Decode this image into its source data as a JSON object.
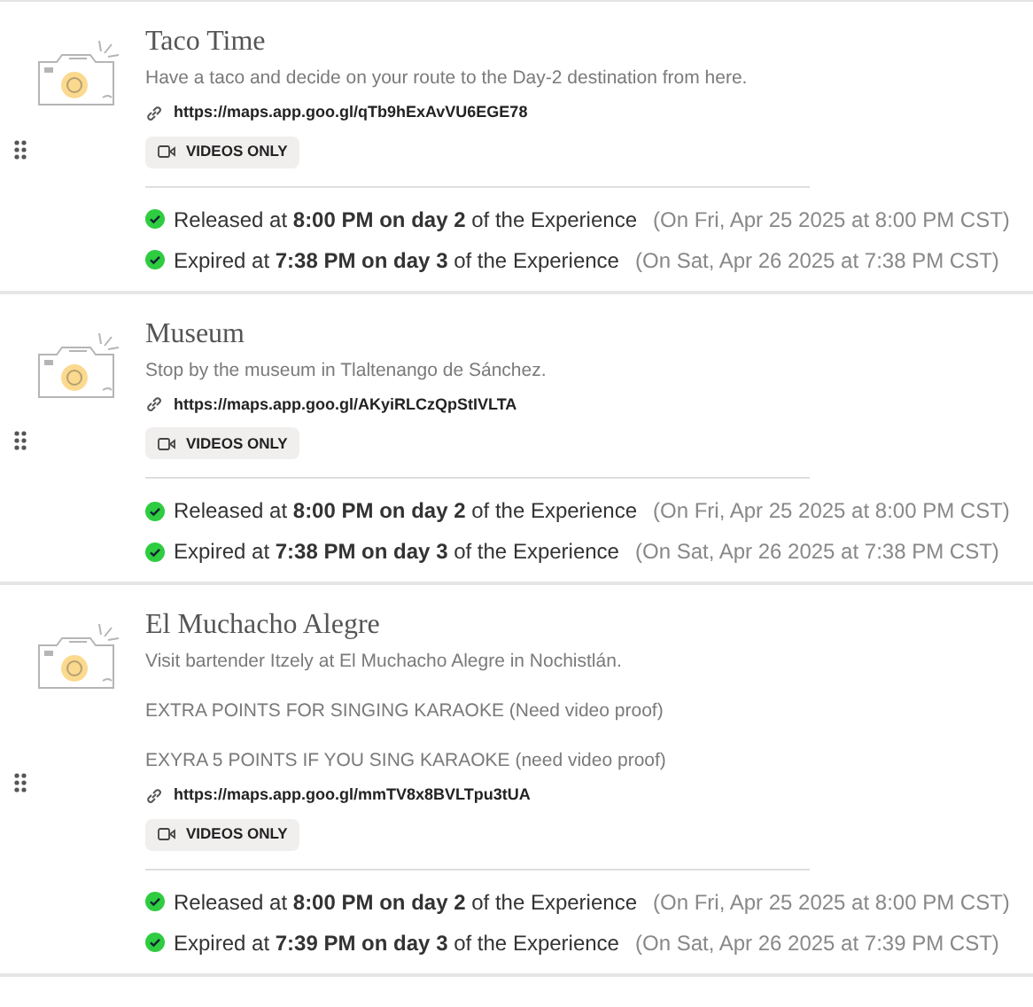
{
  "items": [
    {
      "title": "Taco Time",
      "description": [
        "Have a taco and decide on your route to the Day-2 destination from here."
      ],
      "link": "https://maps.app.goo.gl/qTb9hExAvVU6EGE78",
      "badge": "VIDEOS ONLY",
      "schedule": [
        {
          "text": "Released at **8:00 PM on day 2** of the Experience",
          "date": "(On Fri, Apr 25 2025 at 8:00 PM CST)",
          "done": true
        },
        {
          "text": "Expired at **7:38 PM on day 3** of the Experience",
          "date": "(On Sat, Apr 26 2025 at 7:38 PM CST)",
          "done": true
        }
      ]
    },
    {
      "title": "Museum",
      "description": [
        "Stop by the museum in Tlaltenango de Sánchez."
      ],
      "link": "https://maps.app.goo.gl/AKyiRLCzQpStIVLTA",
      "badge": "VIDEOS ONLY",
      "schedule": [
        {
          "text": "Released at **8:00 PM on day 2** of the Experience",
          "date": "(On Fri, Apr 25 2025 at 8:00 PM CST)",
          "done": true
        },
        {
          "text": "Expired at **7:38 PM on day 3** of the Experience",
          "date": "(On Sat, Apr 26 2025 at 7:38 PM CST)",
          "done": true
        }
      ]
    },
    {
      "title": "El Muchacho Alegre",
      "description": [
        "Visit bartender Itzely at El Muchacho Alegre in Nochistlán.",
        "EXTRA POINTS FOR SINGING KARAOKE (Need video proof)",
        "EXYRA 5 POINTS IF YOU SING KARAOKE (need video proof)"
      ],
      "link": "https://maps.app.goo.gl/mmTV8x8BVLTpu3tUA",
      "badge": "VIDEOS ONLY",
      "schedule": [
        {
          "text": "Released at **8:00 PM on day 2** of the Experience",
          "date": "(On Fri, Apr 25 2025 at 8:00 PM CST)",
          "done": true
        },
        {
          "text": "Expired at **7:39 PM on day 3** of the Experience",
          "date": "(On Sat, Apr 26 2025 at 7:39 PM CST)",
          "done": true
        }
      ]
    }
  ]
}
